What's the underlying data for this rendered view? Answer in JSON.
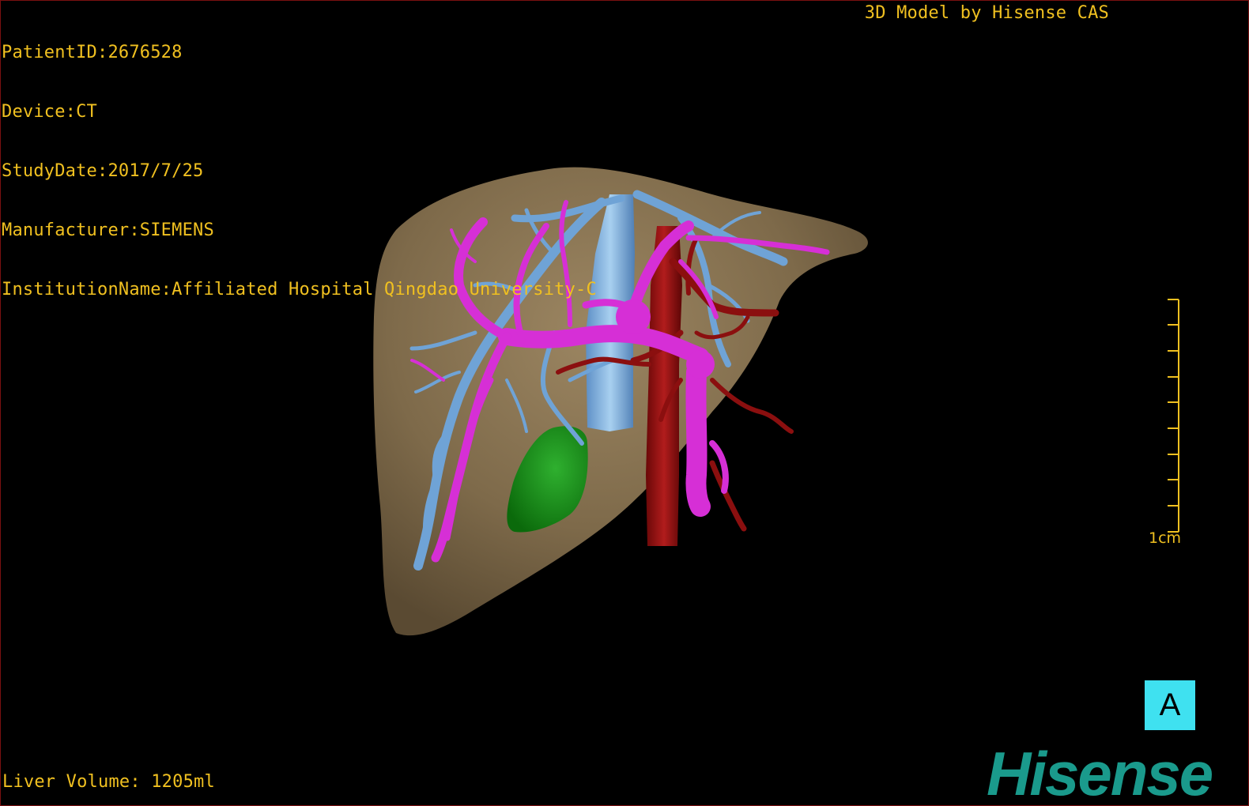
{
  "header": {
    "patient_id": "PatientID:2676528",
    "device": "Device:CT",
    "study_date": "StudyDate:2017/7/25",
    "manufacturer": "Manufacturer:SIEMENS",
    "institution": "InstitutionName:Affiliated Hospital Qingdao University-C"
  },
  "credit": "3D Model by Hisense CAS",
  "scale_bar": {
    "label": "1cm"
  },
  "view_label": "A",
  "footer": {
    "liver_volume": "Liver Volume: 1205ml"
  },
  "brand": "Hisense",
  "colors": {
    "overlay_text": "#f0c020",
    "liver": "#8a7656",
    "hepatic_vein": "#6fa3d6",
    "portal_vein": "#d62fd6",
    "artery": "#8b0f0f",
    "gallbladder": "#1a8f1a",
    "badge": "#3fe1f0",
    "brand": "#1a9a8c"
  }
}
